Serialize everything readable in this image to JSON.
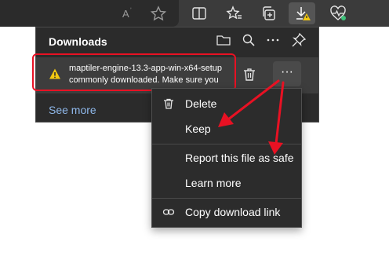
{
  "downloads": {
    "title": "Downloads",
    "item": {
      "filename": "maptiler-engine-13.3-app-win-x64-setup",
      "warning": "commonly downloaded. Make sure you",
      "more_label": "···"
    },
    "see_more": "See more"
  },
  "context_menu": {
    "items": [
      {
        "label": "Delete"
      },
      {
        "label": "Keep"
      },
      {
        "label": "Report this file as safe"
      },
      {
        "label": "Learn more"
      },
      {
        "label": "Copy download link"
      }
    ]
  },
  "colors": {
    "toolbar_bg": "#3b3b3b",
    "panel_bg": "#2b2b2b",
    "menu_bg": "#2c2c2c",
    "link_blue": "#8fb8ea",
    "annotation_red": "#e81123",
    "warning_yellow": "#f2c811"
  },
  "icons": [
    "read-aloud-icon",
    "favorite-icon",
    "split-screen-icon",
    "favorites-icon",
    "collections-icon",
    "download-warning-icon",
    "health-icon",
    "folder-icon",
    "search-icon",
    "more-icon",
    "pin-icon",
    "warning-icon",
    "trash-icon",
    "link-icon"
  ]
}
